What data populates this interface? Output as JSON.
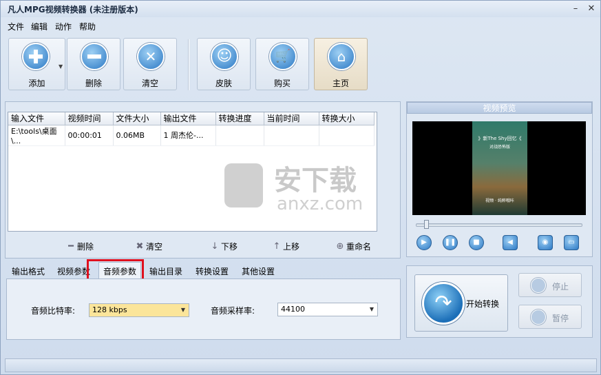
{
  "window": {
    "title": "凡人MPG视频转换器  (未注册版本)"
  },
  "menu": [
    "文件",
    "编辑",
    "动作",
    "帮助"
  ],
  "toolbar": {
    "add": "添加",
    "delete": "删除",
    "clear": "清空",
    "skin": "皮肤",
    "buy": "购买",
    "home": "主页"
  },
  "file_list": {
    "columns": [
      "输入文件",
      "视频时间",
      "文件大小",
      "输出文件",
      "转换进度",
      "当前时间",
      "转换大小"
    ],
    "rows": [
      {
        "input": "E:\\tools\\桌面\\...",
        "duration": "00:00:01",
        "size": "0.06MB",
        "output": "1 周杰伦-...",
        "progress": "",
        "current": "",
        "converted": ""
      }
    ]
  },
  "list_actions": {
    "remove": "删除",
    "clear": "清空",
    "down": "下移",
    "up": "上移",
    "rename": "重命名"
  },
  "tabs": [
    "输出格式",
    "视频参数",
    "音频参数",
    "输出目录",
    "转换设置",
    "其他设置"
  ],
  "audio": {
    "bitrate_label": "音频比特率:",
    "bitrate_value": "128 kbps",
    "samplerate_label": "音频采样率:",
    "samplerate_value": "44100"
  },
  "preview": {
    "title": "视频预览",
    "frame_text_1": "》新The Shy回忆《",
    "frame_text_2": "对战恐怖版",
    "frame_text_3": "视频 · 纯粹哦咔"
  },
  "controls": {
    "start": "开始转换",
    "stop": "停止",
    "pause": "暂停"
  },
  "watermark": {
    "cn": "安下载",
    "en": "anxz.com"
  },
  "colors": {
    "accent": "#2b78c4",
    "highlight": "#e0101e",
    "selected_field": "#fbe59a"
  }
}
